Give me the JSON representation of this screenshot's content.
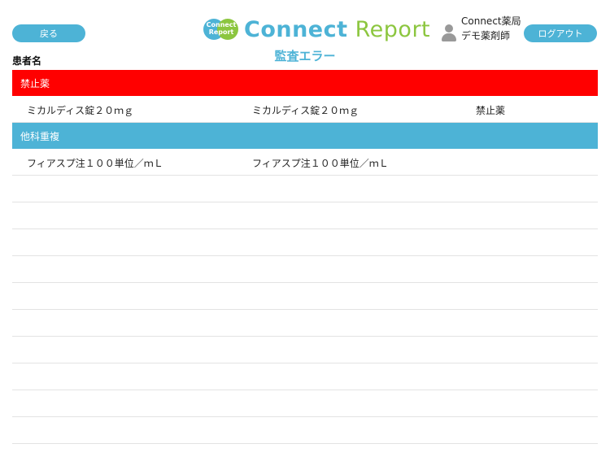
{
  "header": {
    "back_label": "戻る",
    "logout_label": "ログアウト",
    "logo": {
      "badge_line1": "Connect",
      "badge_line2": "Report",
      "word1": "Connect",
      "word2": "Report"
    },
    "title": "監査エラー",
    "user": {
      "pharmacy": "Connect薬局",
      "name": "デモ薬剤師"
    }
  },
  "patient_label": "患者名",
  "sections": [
    {
      "label": "禁止薬",
      "color": "#ff0000",
      "rows": [
        {
          "c1": "ミカルディス錠２０ｍｇ",
          "c2": "ミカルディス錠２０ｍｇ",
          "c3": "禁止薬"
        }
      ]
    },
    {
      "label": "他科重複",
      "color": "#4db3d6",
      "rows": [
        {
          "c1": "フィアスプ注１００単位／ｍＬ",
          "c2": "フィアスプ注１００単位／ｍＬ",
          "c3": ""
        }
      ]
    }
  ],
  "empty_rows": 10
}
